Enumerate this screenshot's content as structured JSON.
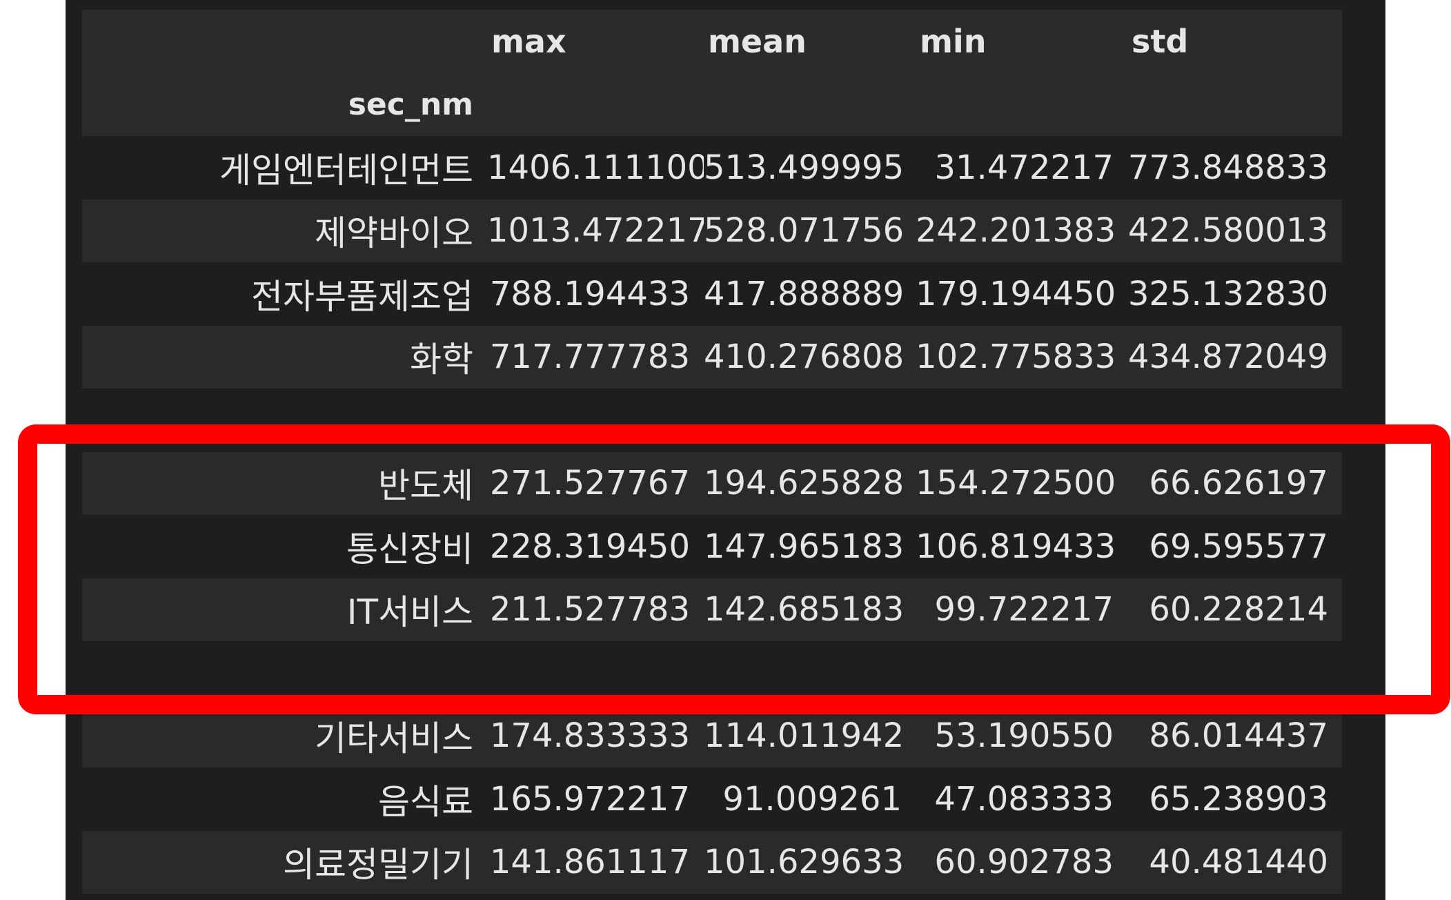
{
  "table": {
    "columns": [
      "max",
      "mean",
      "min",
      "std"
    ],
    "index_name": "sec_nm",
    "rows": [
      {
        "name": "게임엔터테인먼트",
        "max": "1406.111100",
        "mean": "513.499995",
        "min": "31.472217",
        "std": "773.848833"
      },
      {
        "name": "제약바이오",
        "max": "1013.472217",
        "mean": "528.071756",
        "min": "242.201383",
        "std": "422.580013"
      },
      {
        "name": "전자부품제조업",
        "max": "788.194433",
        "mean": "417.888889",
        "min": "179.194450",
        "std": "325.132830"
      },
      {
        "name": "화학",
        "max": "717.777783",
        "mean": "410.276808",
        "min": "102.775833",
        "std": "434.872049"
      },
      {
        "name": "",
        "max": "",
        "mean": "",
        "min": "",
        "std": ""
      },
      {
        "name": "반도체",
        "max": "271.527767",
        "mean": "194.625828",
        "min": "154.272500",
        "std": "66.626197"
      },
      {
        "name": "통신장비",
        "max": "228.319450",
        "mean": "147.965183",
        "min": "106.819433",
        "std": "69.595577"
      },
      {
        "name": "IT서비스",
        "max": "211.527783",
        "mean": "142.685183",
        "min": "99.722217",
        "std": "60.228214"
      },
      {
        "name": "",
        "max": "",
        "mean": "",
        "min": "",
        "std": ""
      },
      {
        "name": "기타서비스",
        "max": "174.833333",
        "mean": "114.011942",
        "min": "53.190550",
        "std": "86.014437"
      },
      {
        "name": "음식료",
        "max": "165.972217",
        "mean": "91.009261",
        "min": "47.083333",
        "std": "65.238903"
      },
      {
        "name": "의료정밀기기",
        "max": "141.861117",
        "mean": "101.629633",
        "min": "60.902783",
        "std": "40.481440"
      }
    ]
  },
  "highlight": {
    "color": "#ff0000"
  }
}
